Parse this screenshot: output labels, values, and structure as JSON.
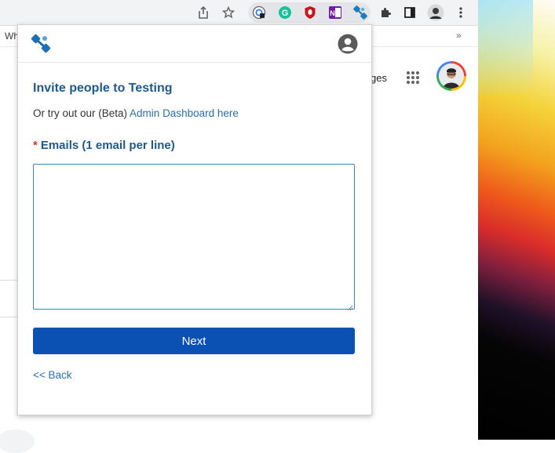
{
  "browser": {
    "bookmark_fragment": "Wh",
    "more_bookmarks": "»",
    "page_text_fragment": "ges"
  },
  "toolbar_icons": [
    "share-icon",
    "bookmark-star-icon",
    "extension-tracker-icon",
    "grammarly-icon",
    "ublock-icon",
    "onenote-icon",
    "link-extension-icon",
    "puzzle-extensions-icon",
    "side-panel-icon",
    "profile-avatar-icon",
    "kebab-menu-icon"
  ],
  "popup": {
    "title": "Invite people to Testing",
    "subline_prefix": "Or try out our (Beta) ",
    "admin_link": "Admin Dashboard here",
    "required_mark": "*",
    "emails_label": "Emails (1 email per line)",
    "emails_value": "",
    "next_label": "Next",
    "back_label": "<< Back"
  },
  "colors": {
    "accent_blue": "#0b50b3",
    "heading_blue": "#1e5a8c",
    "link_blue": "#2a6fb0",
    "required_red": "#d9342b"
  }
}
